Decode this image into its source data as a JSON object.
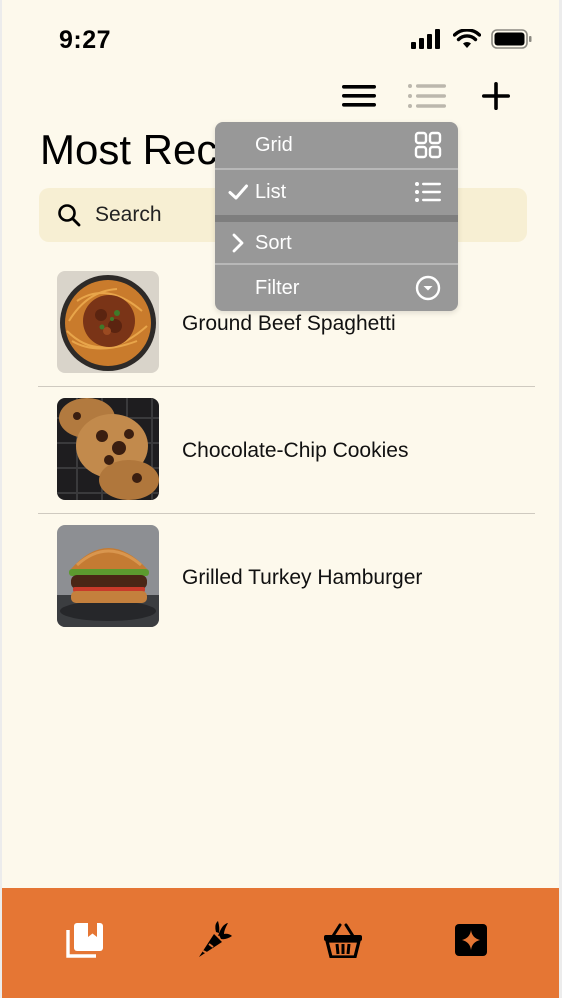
{
  "status_bar": {
    "time": "9:27"
  },
  "toolbar": {
    "icons": [
      "menu-icon",
      "list-view-icon",
      "add-icon"
    ]
  },
  "page": {
    "title": "Most Recent"
  },
  "search": {
    "label": "Search",
    "icon": "search-icon"
  },
  "recipes": [
    {
      "name": "Ground Beef Spaghetti"
    },
    {
      "name": "Chocolate-Chip Cookies"
    },
    {
      "name": "Grilled Turkey Hamburger"
    }
  ],
  "view_menu": {
    "items": [
      {
        "label": "Grid",
        "icon": "grid-icon",
        "checked": false
      },
      {
        "label": "List",
        "icon": "list-icon",
        "checked": true
      },
      {
        "label": "Sort",
        "icon": "chevron-right-icon"
      },
      {
        "label": "Filter",
        "icon": "chevron-down-circle-icon"
      }
    ]
  },
  "tabbar": {
    "tabs": [
      "recipes-book-icon",
      "carrot-icon",
      "basket-icon",
      "sparkle-icon"
    ]
  },
  "colors": {
    "background": "#fdf9ec",
    "search_bg": "#f7efd3",
    "menu_bg": "#989898",
    "tabbar_bg": "#e57634"
  }
}
